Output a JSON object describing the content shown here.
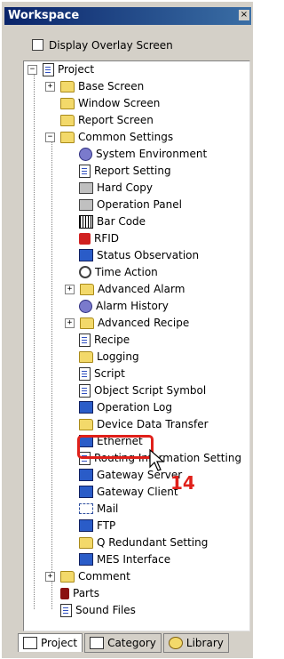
{
  "window": {
    "title": "Workspace",
    "close_glyph": "×"
  },
  "option": {
    "label": "Display Overlay Screen",
    "checked": false
  },
  "tree": {
    "items": [
      {
        "label": "Project",
        "icon": "project-icon"
      },
      {
        "label": "Base Screen",
        "icon": "folder-icon"
      },
      {
        "label": "Window Screen",
        "icon": "folder-icon"
      },
      {
        "label": "Report Screen",
        "icon": "folder-icon"
      },
      {
        "label": "Common Settings",
        "icon": "folder-open-icon"
      },
      {
        "label": "System Environment",
        "icon": "system-environment-icon"
      },
      {
        "label": "Report Setting",
        "icon": "report-setting-icon"
      },
      {
        "label": "Hard Copy",
        "icon": "hard-copy-icon"
      },
      {
        "label": "Operation Panel",
        "icon": "operation-panel-icon"
      },
      {
        "label": "Bar Code",
        "icon": "barcode-icon"
      },
      {
        "label": "RFID",
        "icon": "rfid-icon"
      },
      {
        "label": "Status Observation",
        "icon": "status-observation-icon"
      },
      {
        "label": "Time Action",
        "icon": "clock-icon"
      },
      {
        "label": "Advanced Alarm",
        "icon": "folder-icon"
      },
      {
        "label": "Alarm History",
        "icon": "alarm-history-icon"
      },
      {
        "label": "Advanced Recipe",
        "icon": "folder-icon"
      },
      {
        "label": "Recipe",
        "icon": "recipe-icon"
      },
      {
        "label": "Logging",
        "icon": "folder-icon"
      },
      {
        "label": "Script",
        "icon": "script-icon"
      },
      {
        "label": "Object Script Symbol",
        "icon": "object-script-icon"
      },
      {
        "label": "Operation Log",
        "icon": "operation-log-icon"
      },
      {
        "label": "Device Data Transfer",
        "icon": "folder-icon"
      },
      {
        "label": "Ethernet",
        "icon": "ethernet-icon"
      },
      {
        "label": "Routing Information Setting",
        "icon": "routing-icon"
      },
      {
        "label": "Gateway Server",
        "icon": "gateway-server-icon"
      },
      {
        "label": "Gateway Client",
        "icon": "gateway-client-icon"
      },
      {
        "label": "Mail",
        "icon": "mail-icon"
      },
      {
        "label": "FTP",
        "icon": "ftp-icon"
      },
      {
        "label": "Q Redundant Setting",
        "icon": "q-redundant-icon"
      },
      {
        "label": "MES Interface",
        "icon": "mes-interface-icon"
      },
      {
        "label": "Comment",
        "icon": "folder-icon"
      },
      {
        "label": "Parts",
        "icon": "parts-icon"
      },
      {
        "label": "Sound Files",
        "icon": "sound-files-icon"
      }
    ]
  },
  "annotation": {
    "number": "14"
  },
  "tabs": [
    {
      "label": "Project",
      "active": true
    },
    {
      "label": "Category",
      "active": false
    },
    {
      "label": "Library",
      "active": false
    }
  ],
  "colors": {
    "titlebar": "#0a246a",
    "highlight": "#e0201a"
  }
}
